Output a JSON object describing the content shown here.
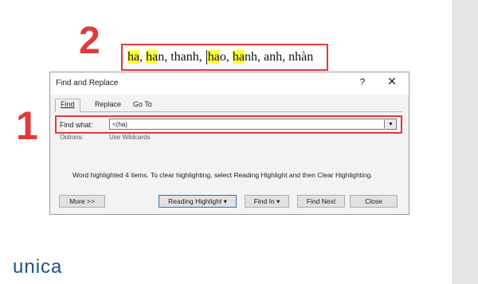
{
  "annotations": {
    "step_2": "2",
    "step_1": "1"
  },
  "document": {
    "segments": [
      {
        "text": "ha",
        "highlight": true
      },
      {
        "text": ", ",
        "highlight": false
      },
      {
        "text": "ha",
        "highlight": true
      },
      {
        "text": "n, thanh, ",
        "highlight": false
      },
      {
        "text": "ha",
        "highlight": true
      },
      {
        "text": "o, ",
        "highlight": false
      },
      {
        "text": "ha",
        "highlight": true
      },
      {
        "text": "nh, anh, nhàn",
        "highlight": false
      }
    ],
    "highlight_color": "#ffff3a"
  },
  "dialog": {
    "title": "Find and Replace",
    "help": "?",
    "close": "✕",
    "tabs": [
      {
        "label": "Find",
        "active": true
      },
      {
        "label": "Replace",
        "active": false
      },
      {
        "label": "Go To",
        "active": false
      }
    ],
    "find_label": "Find what:",
    "find_value": "<(ha)",
    "options_label": "Options:",
    "options_value": "Use Wildcards",
    "message": "Word highlighted 4 items. To clear highlighting, select Reading Highlight and then Clear Highlighting.",
    "buttons": {
      "more": "More >>",
      "reading_highlight": "Reading Highlight ▾",
      "find_in": "Find In ▾",
      "find_next": "Find Next",
      "close": "Close"
    }
  },
  "brand": {
    "logo": "unica",
    "accent_color": "#e8823a",
    "primary_color": "#1c4f8f"
  },
  "annotation_color": "#e03a3a"
}
